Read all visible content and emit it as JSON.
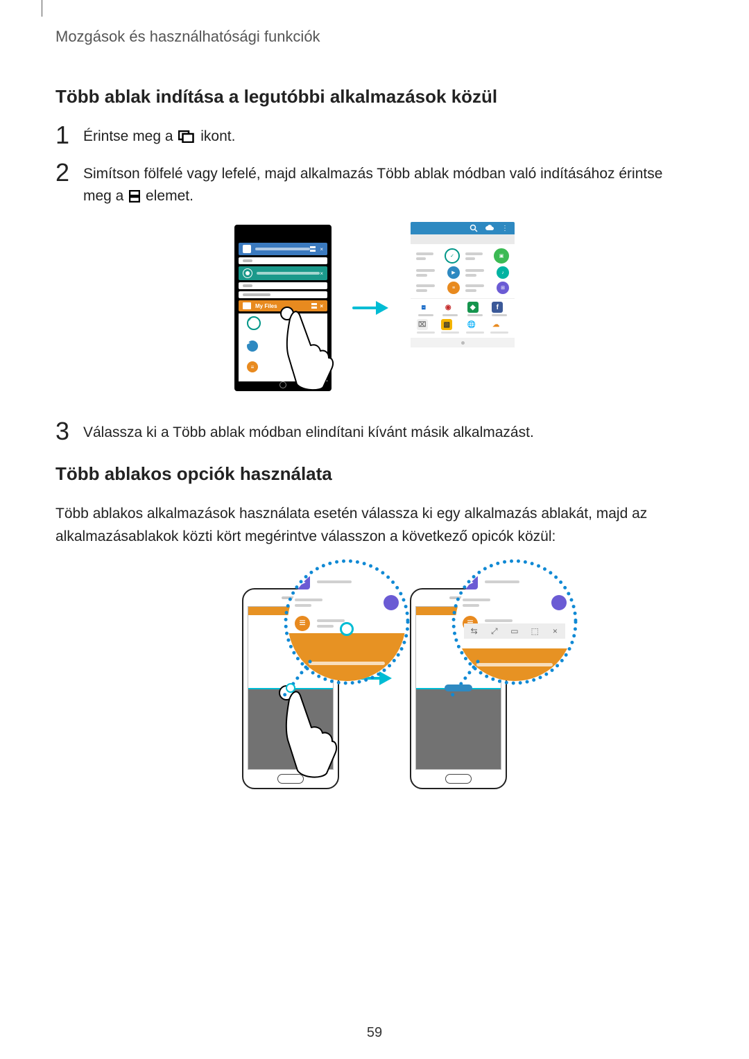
{
  "header": "Mozgások és használhatósági funkciók",
  "section1_title": "Több ablak indítása a legutóbbi alkalmazások közül",
  "step1_pre": "Érintse meg a ",
  "step1_post": " ikont.",
  "step2_pre": "Simítson fölfelé vagy lefelé, majd alkalmazás Több ablak módban való indításához érintse meg a ",
  "step2_post": " elemet.",
  "step3": "Válassza ki a Több ablak módban elindítani kívánt másik alkalmazást.",
  "section2_title": "Több ablakos opciók használata",
  "section2_para": "Több ablakos alkalmazások használata esetén válassza ki egy alkalmazás ablakát, majd az alkalmazásablakok közti kört megérintve válasszon a következő opicók közül:",
  "page_number": "59",
  "fig1": {
    "alt_left": "Telefon képernyő – legutóbbi alkalmazások lista",
    "alt_right": "My Files alkalmazás rácsnézet",
    "myfiles_label": "My Files"
  },
  "fig2": {
    "alt_left": "Több ablak elválasztó érintése – nagyított nézet",
    "alt_right": "Több ablak opciósor – nagyított nézet"
  }
}
